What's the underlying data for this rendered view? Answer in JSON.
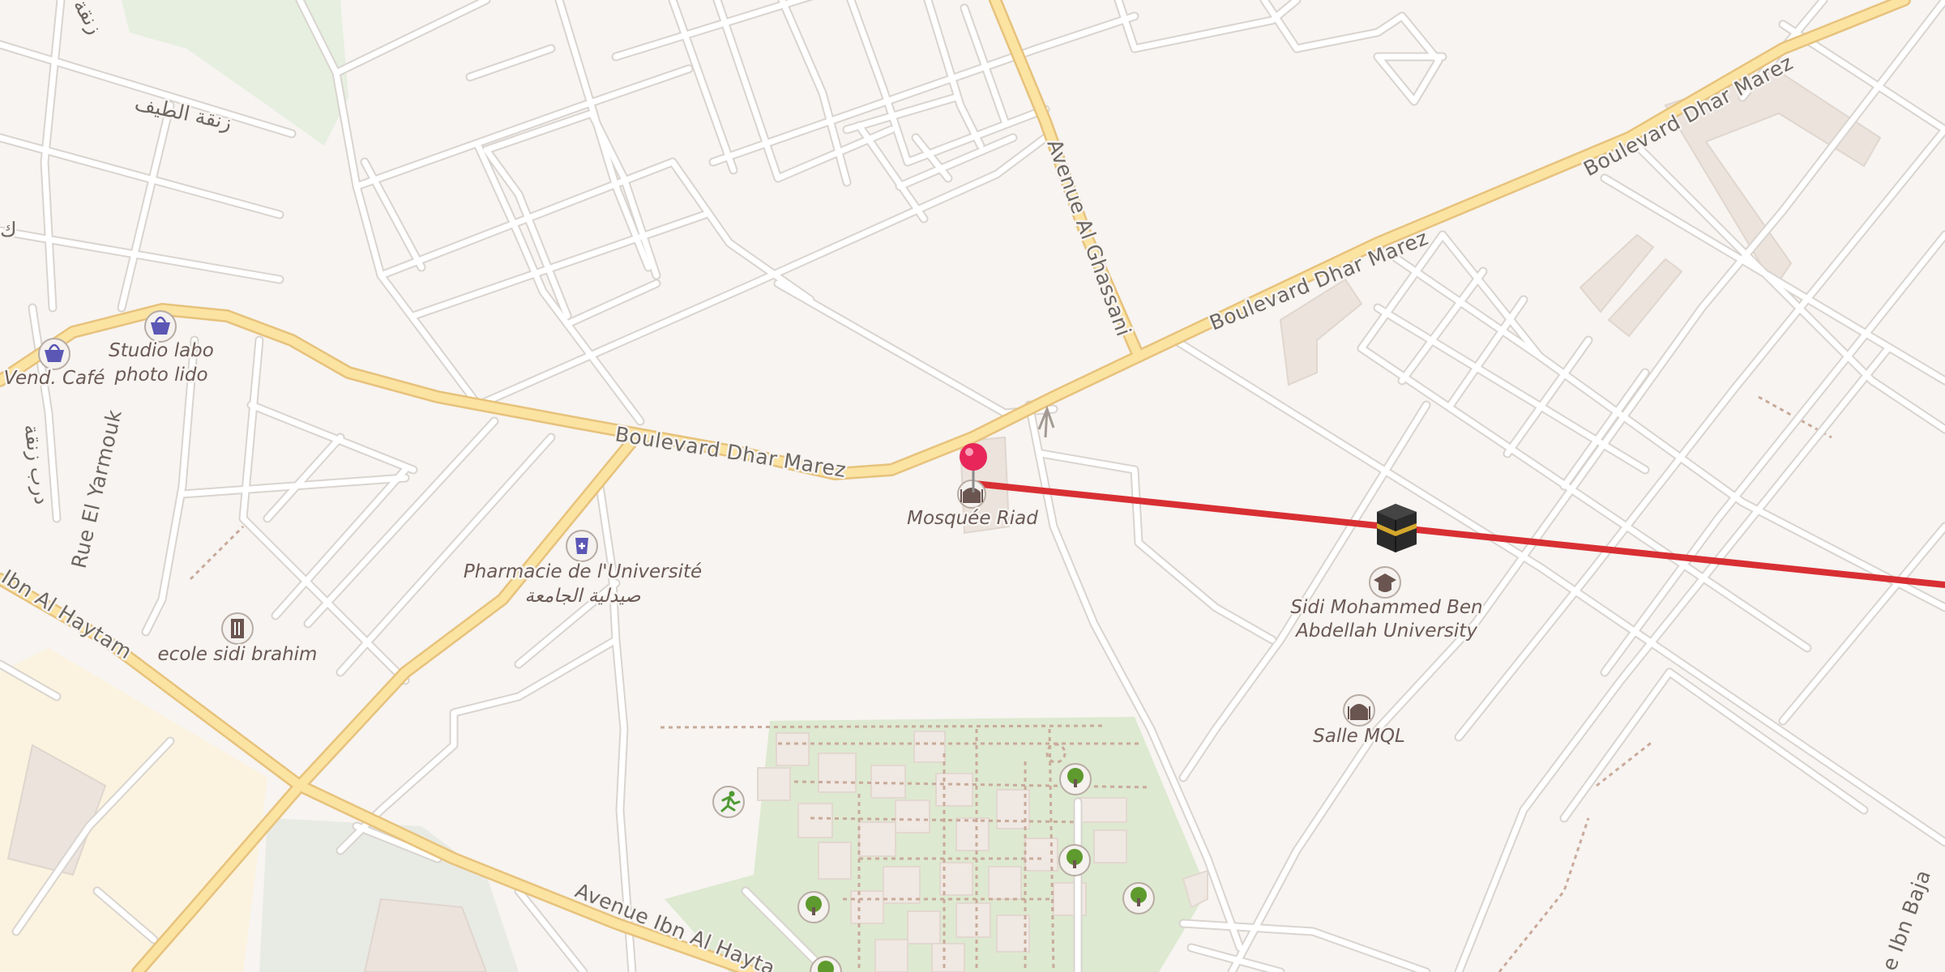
{
  "map": {
    "route_color": "#d82f33",
    "pin_color": "#e8265a"
  },
  "roads": {
    "dhar_marez_1": "Boulevard Dhar Marez",
    "dhar_marez_2": "Boulevard Dhar Marez",
    "dhar_marez_3": "Boulevard Dhar Marez",
    "al_ghassani": "Avenue Al Ghassani",
    "ibn_al_haytam_1": "Ibn Al Haytam",
    "ibn_al_haytam_2": "Avenue Ibn Al Hayta",
    "el_yarmouk": "Rue El Yarmouk",
    "ibn_baja": "e Ibn Baja",
    "arabic_1": "زنقة الطيف",
    "arabic_2": "درب زنقة",
    "arabic_3": "زنقة",
    "arabic_4": "ك"
  },
  "pois": [
    {
      "id": "mosquee",
      "icon": "mosque-icon",
      "label": "Mosquée Riad"
    },
    {
      "id": "pharmacie",
      "icon": "pharmacy-icon",
      "label": "Pharmacie de l'Université",
      "label2": "صيدلية الجامعة"
    },
    {
      "id": "studio",
      "icon": "shop-basket-icon",
      "label": "Studio labo",
      "label2": "photo lido"
    },
    {
      "id": "vend_cafe",
      "icon": "shop-basket-icon",
      "label": "Vend. Café"
    },
    {
      "id": "ecole",
      "icon": "school-icon",
      "label": "ecole sidi brahim"
    },
    {
      "id": "university",
      "icon": "graduation-cap-icon",
      "label": "Sidi Mohammed Ben",
      "label2": "Abdellah University"
    },
    {
      "id": "salle_mql",
      "icon": "mosque-icon",
      "label": "Salle MQL"
    },
    {
      "id": "sport",
      "icon": "running-person-icon"
    },
    {
      "id": "tree1",
      "icon": "tree-icon"
    },
    {
      "id": "tree2",
      "icon": "tree-icon"
    },
    {
      "id": "tree3",
      "icon": "tree-icon"
    },
    {
      "id": "tree4",
      "icon": "tree-icon"
    },
    {
      "id": "tree5",
      "icon": "tree-icon"
    }
  ],
  "markers": {
    "pin": "map-pin-icon",
    "qibla": "kaaba-icon"
  }
}
